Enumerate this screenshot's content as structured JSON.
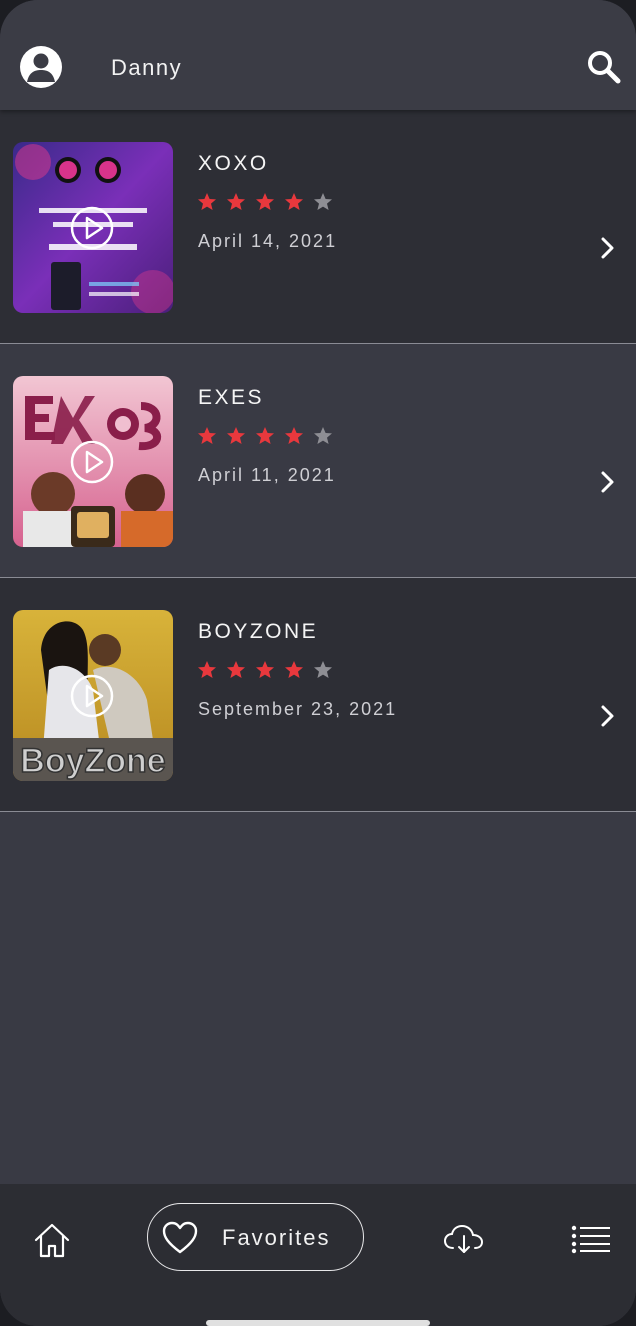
{
  "header": {
    "username": "Danny",
    "avatar_icon": "user-circle-icon",
    "search_icon": "search-icon"
  },
  "colors": {
    "star_filled": "#e8383d",
    "star_empty": "#8e8e94",
    "background": "#393a44",
    "row_dark": "#2d2e35",
    "nav_bg": "#2c2d33"
  },
  "items": [
    {
      "title": "XOXO",
      "rating": 4,
      "max_rating": 5,
      "date": "April 14, 2021"
    },
    {
      "title": "EXES",
      "rating": 4,
      "max_rating": 5,
      "date": "April 11, 2021"
    },
    {
      "title": "BOYZONE",
      "rating": 4,
      "max_rating": 5,
      "date": "September 23, 2021"
    }
  ],
  "bottom_nav": {
    "home_icon": "home-icon",
    "favorites_label": "Favorites",
    "favorites_icon": "heart-icon",
    "download_icon": "cloud-download-icon",
    "list_icon": "list-icon"
  }
}
